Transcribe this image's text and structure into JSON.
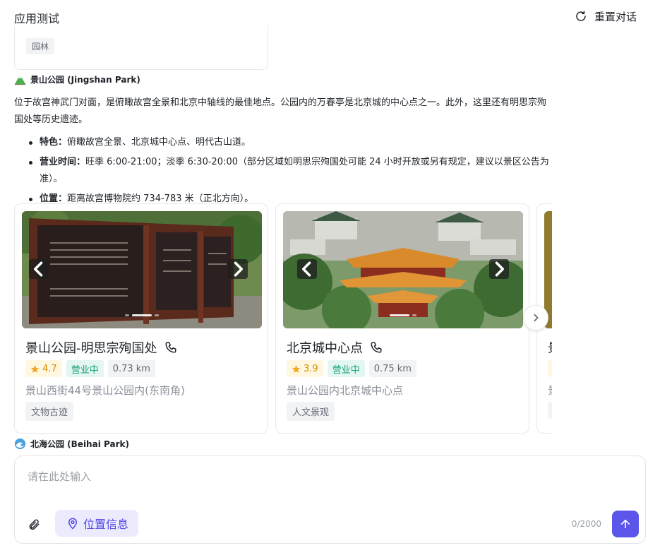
{
  "app": {
    "title": "应用测试",
    "reset_label": "重置对话"
  },
  "prev_card": {
    "tag": "园林"
  },
  "jingshan": {
    "heading": "景山公园 (Jingshan Park)",
    "heading_icon": "mountain-icon",
    "paragraph": "位于故宫神武门对面，是俯瞰故宫全景和北京中轴线的最佳地点。公园内的万春亭是北京城的中心点之一。此外，这里还有明思宗殉国处等历史遗迹。",
    "bullets": [
      {
        "label": "特色",
        "sep": "：",
        "text": "俯瞰故宫全景、北京城中心点、明代古山道。"
      },
      {
        "label": "营业时间",
        "sep": "：",
        "text": "旺季 6:00-21:00；淡季 6:30-20:00（部分区域如明思宗殉国处可能 24 小时开放或另有规定，建议以景区公告为准）。"
      },
      {
        "label": "位置",
        "sep": "：",
        "text": "距离故宫博物院约 734-783 米（正北方向）。"
      }
    ]
  },
  "cards": [
    {
      "title": "景山公园-明思宗殉国处",
      "rating": "4.7",
      "status": "营业中",
      "distance": "0.73 km",
      "address": "景山西街44号景山公园内(东南角)",
      "tag": "文物古迹",
      "photo_subject": "historic-signboard"
    },
    {
      "title": "北京城中心点",
      "rating": "3.9",
      "status": "营业中",
      "distance": "0.75 km",
      "address": "景山公园内北京城中心点",
      "tag": "人文景观",
      "photo_subject": "palace-rooftops"
    },
    {
      "title": "景",
      "address": "景",
      "partial": true
    }
  ],
  "beihai": {
    "heading": "北海公园 (Beihai Park)",
    "heading_icon": "wave-icon"
  },
  "composer": {
    "placeholder": "请在此处输入",
    "location_label": "位置信息",
    "counter": "0/2000"
  },
  "colors": {
    "accent": "#5b55ea",
    "location_bg": "#ecebfd",
    "rating_bg": "#fff7e0",
    "open_bg": "#e3f6f1"
  }
}
